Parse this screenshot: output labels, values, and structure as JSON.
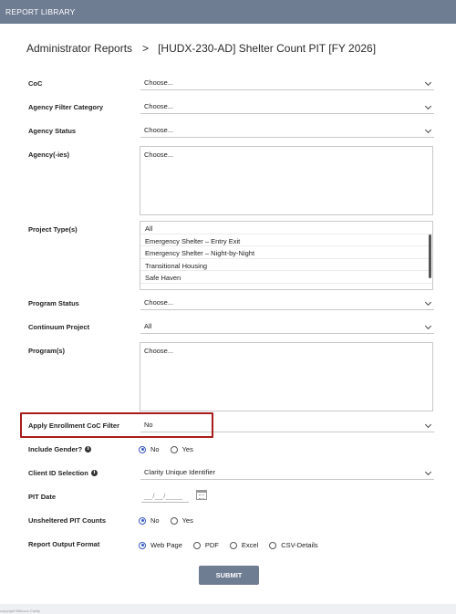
{
  "header": {
    "title": "REPORT LIBRARY"
  },
  "breadcrumb": {
    "parent": "Administrator Reports",
    "separator": ">",
    "current": "[HUDX-230-AD] Shelter Count PIT [FY 2026]"
  },
  "fields": {
    "coc": {
      "label": "CoC",
      "value": "Choose..."
    },
    "agency_filter_category": {
      "label": "Agency Filter Category",
      "value": "Choose..."
    },
    "agency_status": {
      "label": "Agency Status",
      "value": "Choose..."
    },
    "agencies": {
      "label": "Agency(-ies)",
      "value": "Choose..."
    },
    "project_types": {
      "label": "Project Type(s)",
      "options": [
        "All",
        "Emergency Shelter – Entry Exit",
        "Emergency Shelter – Night-by-Night",
        "Transitional Housing",
        "Safe Haven"
      ]
    },
    "program_status": {
      "label": "Program Status",
      "value": "Choose..."
    },
    "continuum_project": {
      "label": "Continuum Project",
      "value": "All"
    },
    "programs": {
      "label": "Program(s)",
      "value": "Choose..."
    },
    "apply_enrollment_coc_filter": {
      "label": "Apply Enrollment CoC Filter",
      "value": "No"
    },
    "include_gender": {
      "label": "Include Gender?",
      "options": [
        "No",
        "Yes"
      ],
      "selected": "No"
    },
    "client_id_selection": {
      "label": "Client ID Selection",
      "value": "Clarity Unique Identifier"
    },
    "pit_date": {
      "label": "PIT Date",
      "placeholder": "__/__/____"
    },
    "unsheltered_pit_counts": {
      "label": "Unsheltered PIT Counts",
      "options": [
        "No",
        "Yes"
      ],
      "selected": "No"
    },
    "report_output_format": {
      "label": "Report Output Format",
      "options": [
        "Web Page",
        "PDF",
        "Excel",
        "CSV-Details"
      ],
      "selected": "Web Page"
    }
  },
  "actions": {
    "submit_label": "SUBMIT"
  },
  "footer": {
    "text": "copyright Bitfocus Clarity"
  },
  "colors": {
    "header_bg": "#6f7d93",
    "radio_accent": "#3a5bbf",
    "highlight_border": "#a81c1c"
  }
}
